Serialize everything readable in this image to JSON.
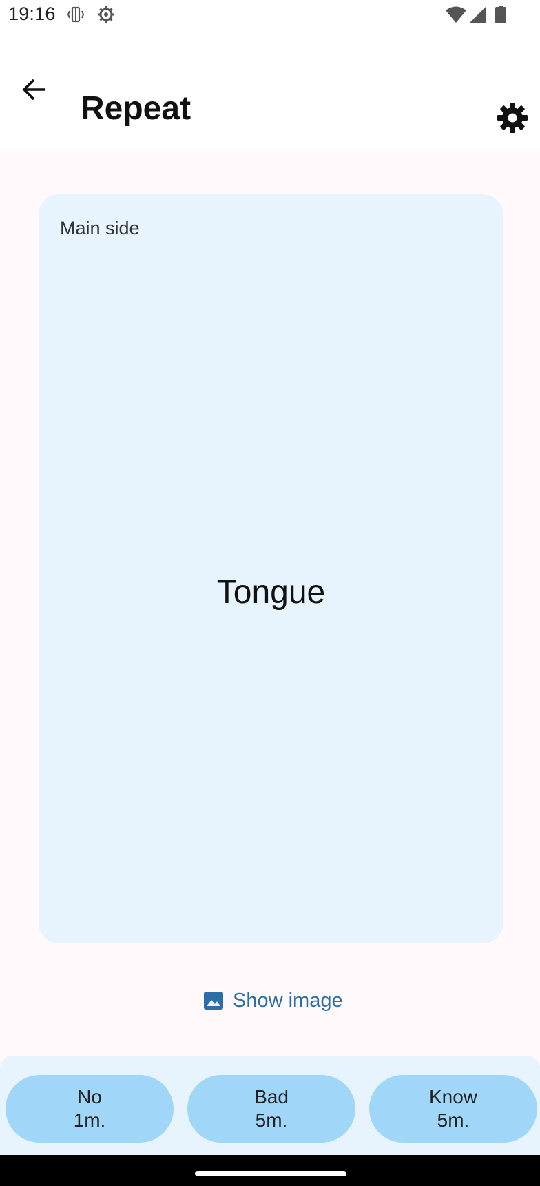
{
  "status_bar": {
    "time": "19:16",
    "icons": [
      "vibrate-icon",
      "settings-gear-status-icon",
      "wifi-icon",
      "cell-signal-icon",
      "battery-icon"
    ]
  },
  "top_bar": {
    "title": "Repeat",
    "back_icon": "arrow-back-icon",
    "settings_icon": "gear-icon"
  },
  "card": {
    "side_label": "Main side",
    "word": "Tongue"
  },
  "show_image": {
    "label": "Show image",
    "icon": "image-icon"
  },
  "answers": [
    {
      "line1": "No",
      "line2": "1m."
    },
    {
      "line1": "Bad",
      "line2": "5m."
    },
    {
      "line1": "Know",
      "line2": "5m."
    }
  ],
  "colors": {
    "background": "#fff9fc",
    "card": "#e7f4fd",
    "answer_button": "#a0d6f8",
    "accent_text": "#2b6ea8"
  }
}
